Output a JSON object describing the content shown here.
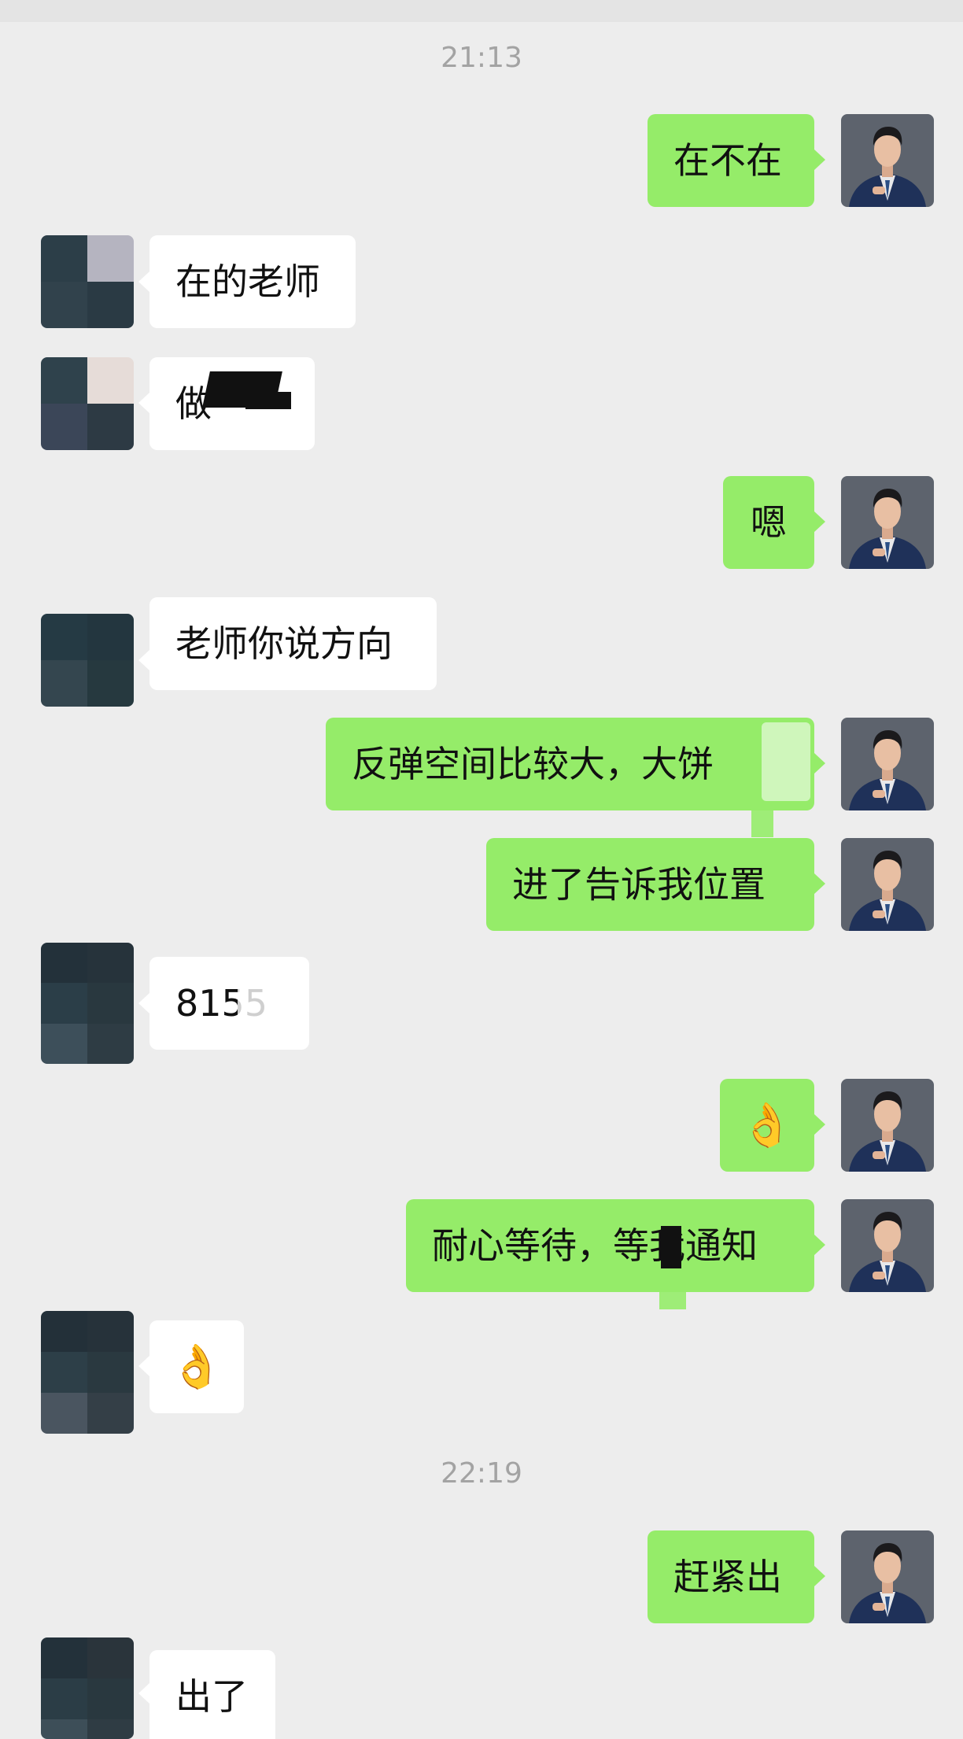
{
  "colors": {
    "background": "#ededed",
    "outgoing": "#95ec69",
    "incoming": "#ffffff",
    "timestamp": "#a3a3a3"
  },
  "timestamps": [
    "21:13",
    "22:19"
  ],
  "messages": [
    {
      "side": "out",
      "text": "在不在"
    },
    {
      "side": "in",
      "text": "在的老师"
    },
    {
      "side": "in",
      "text": "做"
    },
    {
      "side": "out",
      "text": "嗯"
    },
    {
      "side": "in",
      "text": "老师你说方向"
    },
    {
      "side": "out",
      "text": "反弹空间比较大，大饼"
    },
    {
      "side": "out",
      "text": "进了告诉我位置"
    },
    {
      "side": "in",
      "text": "8155"
    },
    {
      "side": "out",
      "text": "👌"
    },
    {
      "side": "out",
      "text": "耐心等待，等我通知"
    },
    {
      "side": "in",
      "text": "👌"
    },
    {
      "side": "out",
      "text": "赶紧出"
    },
    {
      "side": "in",
      "text": "出了"
    }
  ]
}
